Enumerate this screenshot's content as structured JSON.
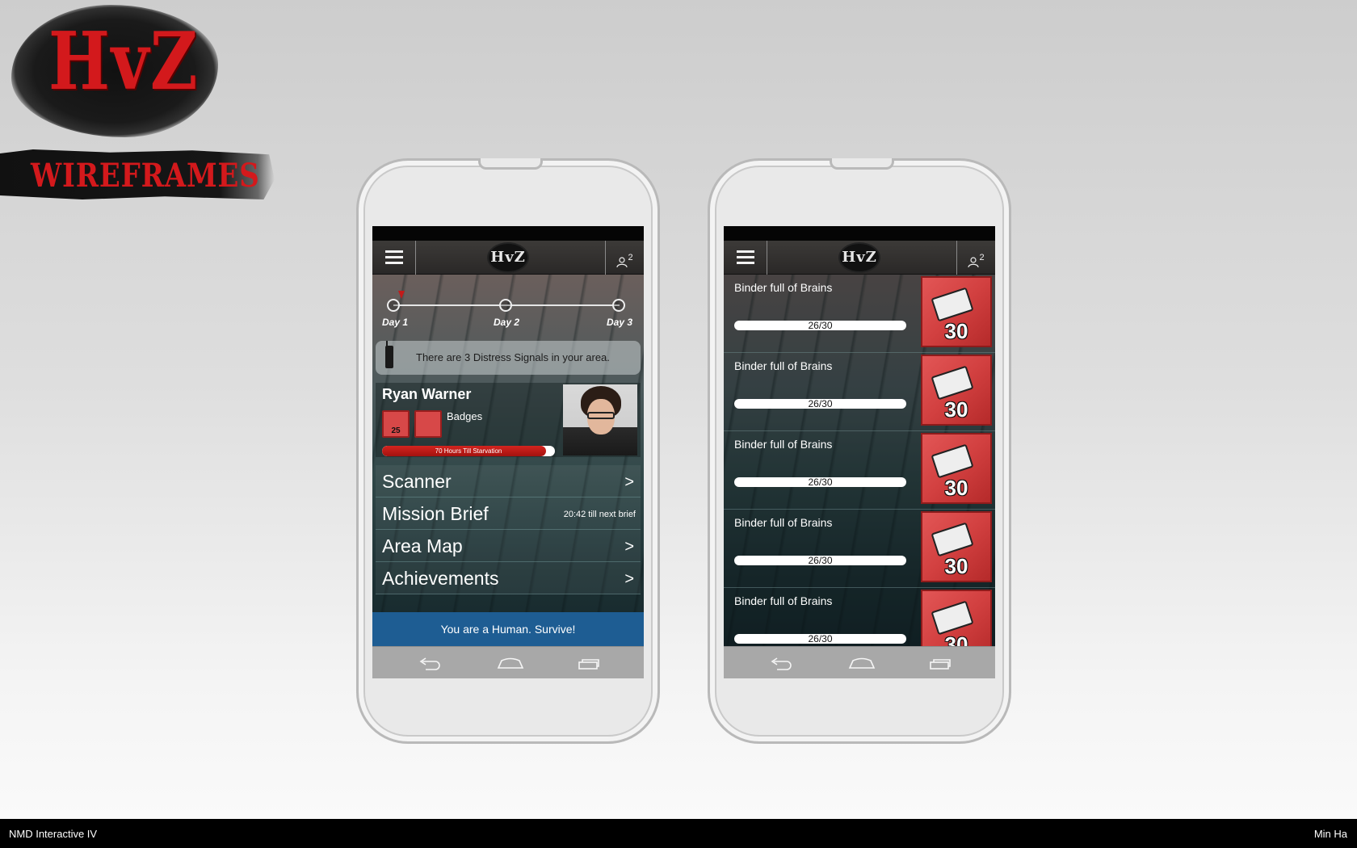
{
  "logo": {
    "brand": "HvZ",
    "subtitle": "WIREFRAMES"
  },
  "screen1": {
    "app_logo": "HvZ",
    "profile_count": "2",
    "timeline": {
      "days": [
        "Day 1",
        "Day 2",
        "Day 3"
      ]
    },
    "distress": {
      "text": "There are 3 Distress Signals in your area."
    },
    "player": {
      "name": "Ryan Warner",
      "badges_label": "Badges",
      "badge1_count": "25",
      "starvation_text": "70 Hours Till Starvation",
      "starvation_fraction": 0.95
    },
    "menu": {
      "scanner": "Scanner",
      "scanner_chev": ">",
      "mission": "Mission Brief",
      "mission_sub": "20:42 till next brief",
      "area_map": "Area Map",
      "area_chev": ">",
      "achievements": "Achievements",
      "ach_chev": ">"
    },
    "status": "You are a Human. Survive!"
  },
  "screen2": {
    "app_logo": "HvZ",
    "profile_count": "2",
    "achievements": [
      {
        "title": "Binder full of Brains",
        "progress": "26/30",
        "badge": "30"
      },
      {
        "title": "Binder full of Brains",
        "progress": "26/30",
        "badge": "30"
      },
      {
        "title": "Binder full of Brains",
        "progress": "26/30",
        "badge": "30"
      },
      {
        "title": "Binder full of Brains",
        "progress": "26/30",
        "badge": "30"
      },
      {
        "title": "Binder full of Brains",
        "progress": "26/30",
        "badge": "30"
      }
    ]
  },
  "footer": {
    "left": "NMD Interactive IV",
    "right": "Min Ha"
  }
}
